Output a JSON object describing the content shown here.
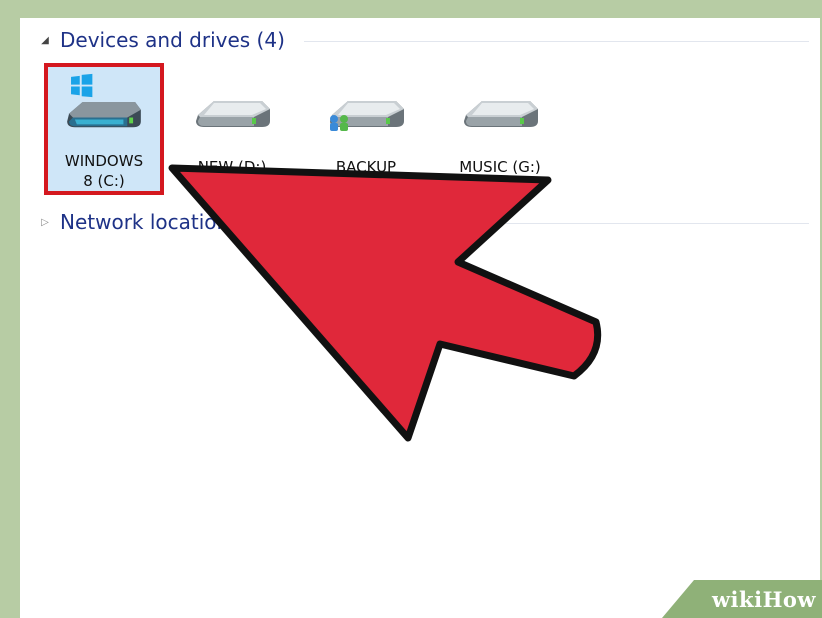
{
  "groups": {
    "devices": {
      "label": "Devices and drives (4)",
      "expanded": true
    },
    "network": {
      "label": "Network locations",
      "expanded": false
    }
  },
  "drives": [
    {
      "label": "WINDOWS\n8 (C:)",
      "icon": "windows-drive-icon",
      "selected": true
    },
    {
      "label": "NEW (D:)",
      "icon": "hard-drive-icon",
      "selected": false
    },
    {
      "label": "BACKUP",
      "icon": "network-drive-icon",
      "selected": false
    },
    {
      "label": "MUSIC (G:)",
      "icon": "hard-drive-icon",
      "selected": false
    }
  ],
  "watermark": "wikiHow",
  "colors": {
    "accent_red": "#e0283a",
    "selection_blue": "#cfe6f8",
    "header_blue": "#1e3287",
    "frame_green": "#b7cca4"
  }
}
